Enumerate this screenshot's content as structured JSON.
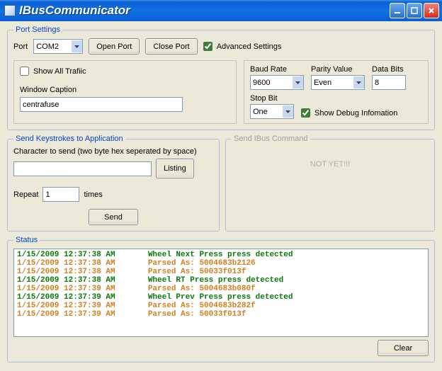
{
  "window": {
    "title": "IBusCommunicator"
  },
  "portSettings": {
    "legend": "Port Settings",
    "portLabel": "Port",
    "port": "COM2",
    "openPort": "Open Port",
    "closePort": "Close Port",
    "advancedSettings": "Advanced Settings",
    "showAllTraffic": "Show All Trafiic",
    "windowCaptionLabel": "Window Caption",
    "windowCaption": "centrafuse",
    "baudRateLabel": "Baud Rate",
    "baudRate": "9600",
    "parityLabel": "Parity Value",
    "parity": "Even",
    "dataBitsLabel": "Data Bits",
    "dataBits": "8",
    "stopBitLabel": "Stop Bit",
    "stopBit": "One",
    "showDebug": "Show Debug Infomation"
  },
  "keystrokes": {
    "legend": "Send Keystrokes to Application",
    "charLabel": "Character to send (two byte hex seperated by space)",
    "charValue": "",
    "listing": "Listing",
    "repeatLabel": "Repeat",
    "repeatValue": "1",
    "timesLabel": "times",
    "send": "Send"
  },
  "ibusCommand": {
    "legend": "Send IBus Command",
    "notyet": "NOT  YET!!!"
  },
  "status": {
    "legend": "Status",
    "lines": [
      {
        "ts": "1/15/2009 12:37:38 AM",
        "msg": "Wheel Next Press press detected",
        "c": "g"
      },
      {
        "ts": "1/15/2009 12:37:38 AM",
        "msg": "Parsed As: 5004683b2126",
        "c": "o"
      },
      {
        "ts": "1/15/2009 12:37:38 AM",
        "msg": "Parsed As: 50033f013f",
        "c": "o"
      },
      {
        "ts": "1/15/2009 12:37:38 AM",
        "msg": "Wheel RT Press press detected",
        "c": "g"
      },
      {
        "ts": "1/15/2009 12:37:39 AM",
        "msg": "Parsed As: 5004683b080f",
        "c": "o"
      },
      {
        "ts": "1/15/2009 12:37:39 AM",
        "msg": "Wheel Prev Press press detected",
        "c": "g"
      },
      {
        "ts": "1/15/2009 12:37:39 AM",
        "msg": "Parsed As: 5004683b282f",
        "c": "o"
      },
      {
        "ts": "1/15/2009 12:37:39 AM",
        "msg": "Parsed As: 50033f013f",
        "c": "o"
      }
    ]
  },
  "clear": "Clear"
}
